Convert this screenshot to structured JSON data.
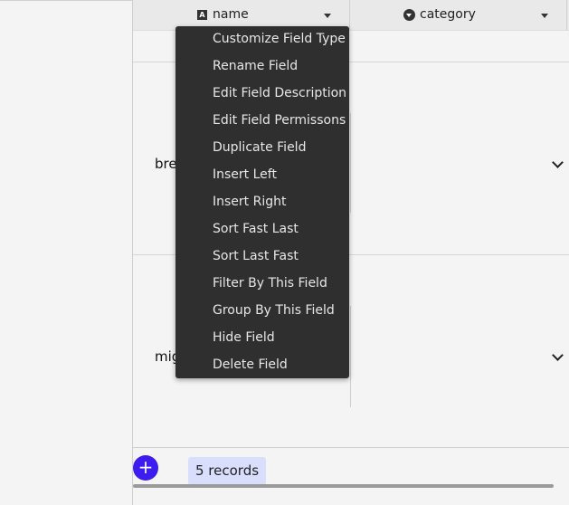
{
  "header": {
    "name_column": {
      "label": "name",
      "icon": "text-type-icon",
      "icon_glyph": "A"
    },
    "category_column": {
      "label": "category",
      "icon": "select-type-icon"
    }
  },
  "rows": [
    {
      "name": ""
    },
    {
      "name": "brett"
    },
    {
      "name": "migwi"
    }
  ],
  "context_menu": {
    "items": [
      "Customize Field Type",
      "Rename Field",
      "Edit Field Description",
      "Edit Field Permissons",
      "Duplicate Field",
      "Insert Left",
      "Insert Right",
      "Sort Fast Last",
      "Sort Last Fast",
      "Filter By This Field",
      "Group By This Field",
      "Hide Field",
      "Delete Field"
    ]
  },
  "footer": {
    "add_label": "+",
    "records_label": "5 records"
  },
  "colors": {
    "accent": "#3d1cf0",
    "badge_bg": "#d9defd",
    "menu_bg": "#2f2f2f"
  }
}
